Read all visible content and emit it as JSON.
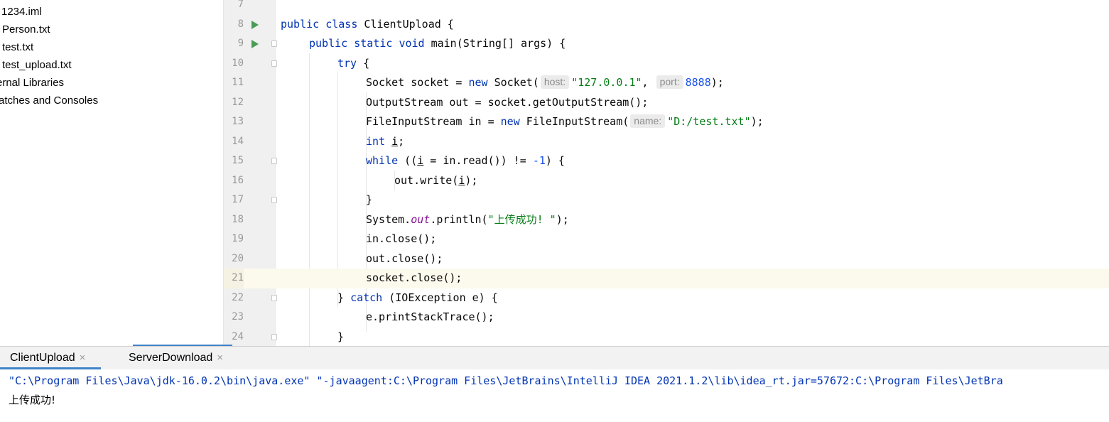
{
  "project_tree": {
    "items": [
      {
        "label": "1234.iml"
      },
      {
        "label": "Person.txt"
      },
      {
        "label": "test.txt"
      },
      {
        "label": "test_upload.txt"
      },
      {
        "label": "ernal Libraries"
      },
      {
        "label": "ratches and Consoles"
      }
    ]
  },
  "editor": {
    "lines": [
      {
        "num": "7"
      },
      {
        "num": "8",
        "kw1": "public",
        "kw2": "class",
        "rest": " ClientUpload {"
      },
      {
        "num": "9",
        "kw1": "public",
        "kw2": "static",
        "kw3": "void",
        "rest": " main(String[] args) {"
      },
      {
        "num": "10",
        "kw1": "try",
        "rest": " {"
      },
      {
        "num": "11",
        "a": "Socket socket = ",
        "kw1": "new",
        "b": " Socket(",
        "hint1": "host:",
        "str1": "\"127.0.0.1\"",
        "c": ", ",
        "hint2": "port:",
        "num1": "8888",
        "d": ");"
      },
      {
        "num": "12",
        "a": "OutputStream out = socket.getOutputStream();"
      },
      {
        "num": "13",
        "a": "FileInputStream in = ",
        "kw1": "new",
        "b": " FileInputStream(",
        "hint1": "name:",
        "str1": "\"D:/test.txt\"",
        "d": ");"
      },
      {
        "num": "14",
        "kw1": "int",
        "a": " ",
        "var": "i",
        "b": ";"
      },
      {
        "num": "15",
        "kw1": "while",
        "a": " ((",
        "var": "i",
        "b": " = in.read()) != ",
        "num1": "-1",
        "c": ") {"
      },
      {
        "num": "16",
        "a": "out.write(",
        "var": "i",
        "b": ");"
      },
      {
        "num": "17",
        "a": "}"
      },
      {
        "num": "18",
        "a": "System.",
        "field": "out",
        "b": ".println(",
        "str1": "\"上传成功! \"",
        "c": ");"
      },
      {
        "num": "19",
        "a": "in.close();"
      },
      {
        "num": "20",
        "a": "out.close();"
      },
      {
        "num": "21",
        "a": "socket.close();"
      },
      {
        "num": "22",
        "a": "} ",
        "kw1": "catch",
        "b": " (IOException e) {"
      },
      {
        "num": "23",
        "a": "e.printStackTrace();"
      },
      {
        "num": "24",
        "a": "}"
      }
    ]
  },
  "run_panel": {
    "tabs": [
      {
        "label": "ClientUpload",
        "close": "×"
      },
      {
        "label": "ServerDownload",
        "close": "×"
      }
    ],
    "console": {
      "command": "\"C:\\Program Files\\Java\\jdk-16.0.2\\bin\\java.exe\" \"-javaagent:C:\\Program Files\\JetBrains\\IntelliJ IDEA 2021.1.2\\lib\\idea_rt.jar=57672:C:\\Program Files\\JetBra",
      "output": "上传成功!"
    }
  },
  "colors": {
    "keyword": "#0033b3",
    "string": "#067d17",
    "number": "#1750eb",
    "static_field": "#871094",
    "run_icon": "#499c54",
    "tab_underline": "#4083c9",
    "current_line": "#fcfaed"
  },
  "icons": [
    "run-gutter-icon",
    "fold-icon",
    "close-icon"
  ]
}
